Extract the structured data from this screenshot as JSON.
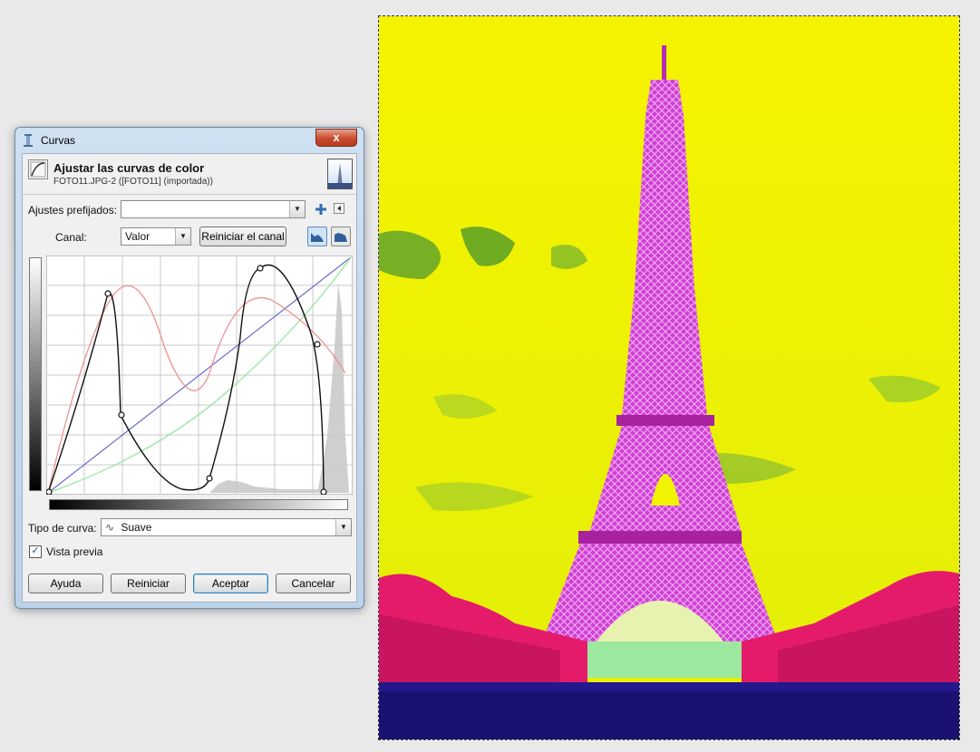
{
  "dialog": {
    "window_title": "Curvas",
    "close_label": "x",
    "header_title": "Ajustar las curvas de color",
    "header_subtitle": "FOTO11.JPG-2 ([FOTO11] (importada))",
    "presets_label": "Ajustes prefijados:",
    "presets_value": "",
    "channel_label": "Canal:",
    "channel_value": "Valor",
    "reset_channel_label": "Reiniciar el canal",
    "curve_type_label": "Tipo de curva:",
    "curve_type_value": "Suave",
    "preview_label": "Vista previa",
    "preview_checked": true,
    "buttons": {
      "help": "Ayuda",
      "reset": "Reiniciar",
      "ok": "Aceptar",
      "cancel": "Cancelar"
    }
  },
  "curves": {
    "value_curve_color": "#111111",
    "red_curve_color": "#ef8a8a",
    "green_curve_color": "#8fe69a",
    "blue_curve_color": "#6a6ad0"
  },
  "canvas": {
    "sky_color": "#f1f400",
    "tower_color": "#d33bd0",
    "trees_color": "#e8216a",
    "ground_color": "#241a8c"
  },
  "icons": {
    "title": "curves-icon",
    "header": "curves-tool-icon",
    "add_preset": "plus-icon",
    "preset_menu": "menu-arrow-icon",
    "linear_hist": "linear-histogram-icon",
    "log_hist": "log-histogram-icon",
    "curve_type": "smooth-curve-icon"
  }
}
